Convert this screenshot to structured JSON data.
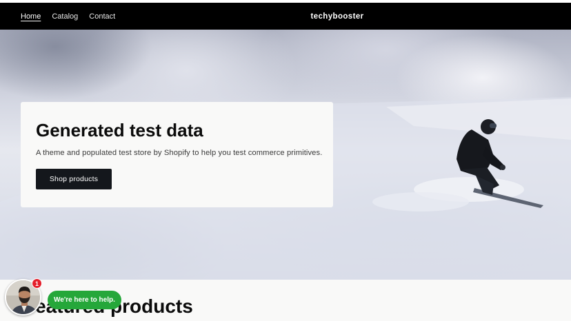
{
  "header": {
    "nav": [
      {
        "label": "Home",
        "active": true
      },
      {
        "label": "Catalog",
        "active": false
      },
      {
        "label": "Contact",
        "active": false
      }
    ],
    "brand": "techybooster"
  },
  "hero": {
    "title": "Generated test data",
    "subtitle": "A theme and populated test store by Shopify to help you test commerce primitives.",
    "button_label": "Shop products"
  },
  "featured": {
    "title": "Featured products"
  },
  "chat_widget": {
    "badge_count": "1",
    "message": "We're here to help.",
    "bubble_color": "#25a73a",
    "badge_color": "#e4202b"
  },
  "icons": [
    "snowboarder-photo",
    "agent-avatar-icon"
  ]
}
